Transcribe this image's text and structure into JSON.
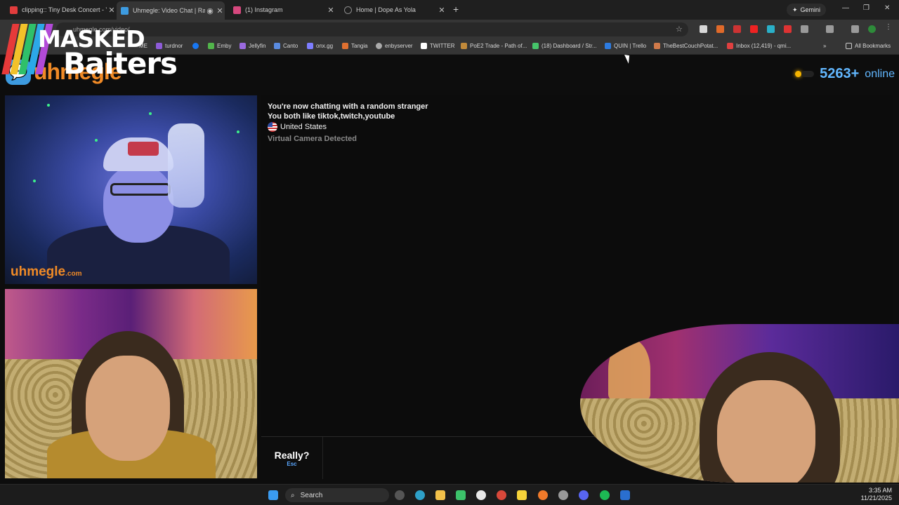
{
  "browser": {
    "tabs": [
      {
        "title": "clipping:: Tiny Desk Concert - Y",
        "color": "#e23d3d",
        "active": false
      },
      {
        "title": "Uhmegle: Video Chat | Ran",
        "color": "#3d9be0",
        "active": true
      },
      {
        "title": "(1) Instagram",
        "color": "#d6487e",
        "active": false
      },
      {
        "title": "Home | Dope As Yola",
        "color": "#8a8a8a",
        "active": false
      }
    ],
    "gemini_label": "Gemini",
    "address": "uhmegle.com/video/",
    "bookmarks": [
      {
        "label": "ME",
        "color": "#3b7bd8"
      },
      {
        "label": "turdnor",
        "color": "#8e5bd8"
      },
      {
        "label": "",
        "color": "#1877f2"
      },
      {
        "label": "Emby",
        "color": "#52b54b"
      },
      {
        "label": "Jellyfin",
        "color": "#9b6ae0"
      },
      {
        "label": "Canto",
        "color": "#5a8be0"
      },
      {
        "label": "onx.gg",
        "color": "#7d7dff"
      },
      {
        "label": "Tangia",
        "color": "#e07030"
      },
      {
        "label": "enbyserver",
        "color": "#aaaaaa"
      },
      {
        "label": "TWITTER",
        "color": "#ffffff"
      },
      {
        "label": "PoE2 Trade - Path of...",
        "color": "#c28a3a"
      },
      {
        "label": "(18) Dashboard / Str...",
        "color": "#46c46a"
      },
      {
        "label": "QUIN | Trello",
        "color": "#2d7be0"
      },
      {
        "label": "TheBestCouchPotat...",
        "color": "#d07a4a"
      },
      {
        "label": "Inbox (12,419) - qmi...",
        "color": "#e04040"
      }
    ],
    "all_bookmarks": "All Bookmarks"
  },
  "overlay": {
    "word1": "MASKED",
    "word2": "Baiters",
    "stripes": [
      "#e63a3a",
      "#f2c12a",
      "#2fc06a",
      "#2ca8e8",
      "#b24ad8"
    ]
  },
  "site": {
    "logo_text": "uhmegle",
    "online_count": "5263+",
    "online_label": "online",
    "video_watermark": "uhmegle",
    "video_watermark_suffix": ".com"
  },
  "chat": {
    "line1": "You're now chatting with a random stranger",
    "line2": "You both like tiktok,twitch,youtube",
    "country": "United States",
    "notice": "Virtual Camera Detected",
    "skip_label": "Really?",
    "skip_hint": "Esc"
  },
  "taskbar": {
    "search_label": "Search",
    "time": "3:35 AM",
    "date": "11/21/2025"
  }
}
